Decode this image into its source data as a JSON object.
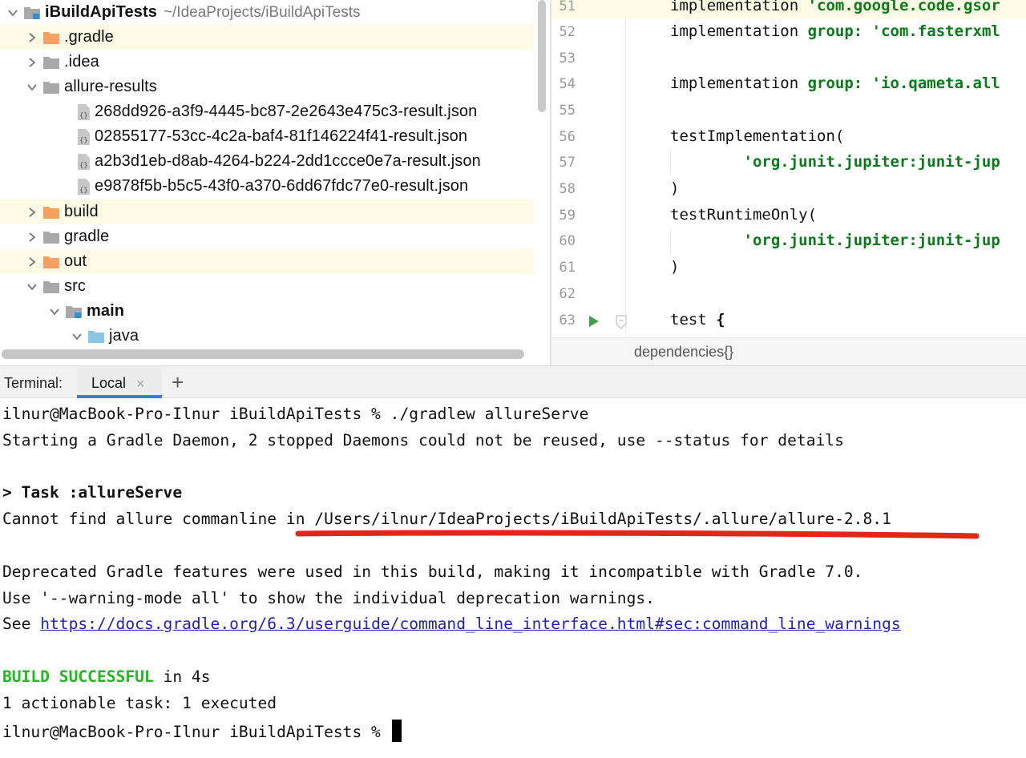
{
  "project_tree": {
    "root": {
      "label": "iBuildApiTests",
      "path": "~/IdeaProjects/iBuildApiTests"
    },
    "items": [
      {
        "label": ".gradle",
        "kind": "folder-orange",
        "expanded": false
      },
      {
        "label": ".idea",
        "kind": "folder-gray",
        "expanded": false
      },
      {
        "label": "allure-results",
        "kind": "folder-gray",
        "expanded": true
      },
      {
        "label": "268dd926-a3f9-4445-bc87-2e2643e475c3-result.json",
        "kind": "json-file"
      },
      {
        "label": "02855177-53cc-4c2a-baf4-81f146224f41-result.json",
        "kind": "json-file"
      },
      {
        "label": "a2b3d1eb-d8ab-4264-b224-2dd1ccce0e7a-result.json",
        "kind": "json-file"
      },
      {
        "label": "e9878f5b-b5c5-43f0-a370-6dd67fdc77e0-result.json",
        "kind": "json-file"
      },
      {
        "label": "build",
        "kind": "folder-orange",
        "expanded": false
      },
      {
        "label": "gradle",
        "kind": "folder-gray",
        "expanded": false
      },
      {
        "label": "out",
        "kind": "folder-orange",
        "expanded": false
      },
      {
        "label": "src",
        "kind": "folder-gray",
        "expanded": true
      },
      {
        "label": "main",
        "kind": "module-folder",
        "expanded": true
      },
      {
        "label": "java",
        "kind": "source-folder",
        "expanded": true
      }
    ]
  },
  "editor": {
    "lines": [
      {
        "num": "51",
        "p1": "implementation ",
        "p2": "",
        "p3": "'com.google.code.gsor"
      },
      {
        "num": "52",
        "p1": "implementation ",
        "p2": "group: ",
        "p3": "'com.fasterxml"
      },
      {
        "num": "53",
        "p1": "",
        "p2": "",
        "p3": ""
      },
      {
        "num": "54",
        "p1": "implementation ",
        "p2": "group: ",
        "p3": "'io.qameta.all"
      },
      {
        "num": "55",
        "p1": "",
        "p2": "",
        "p3": ""
      },
      {
        "num": "56",
        "p1": "testImplementation(",
        "p2": "",
        "p3": ""
      },
      {
        "num": "57",
        "p1": "        ",
        "p2": "",
        "p3": "'org.junit.jupiter:junit-jup"
      },
      {
        "num": "58",
        "p1": ")",
        "p2": "",
        "p3": ""
      },
      {
        "num": "59",
        "p1": "testRuntimeOnly(",
        "p2": "",
        "p3": ""
      },
      {
        "num": "60",
        "p1": "        ",
        "p2": "",
        "p3": "'org.junit.jupiter:junit-jup"
      },
      {
        "num": "61",
        "p1": ")",
        "p2": "",
        "p3": ""
      },
      {
        "num": "62",
        "p1": "",
        "p2": "",
        "p3": ""
      },
      {
        "num": "63",
        "p1": "test ",
        "p2": "",
        "p3": "",
        "brace": "{"
      }
    ],
    "breadcrumb": "dependencies{}"
  },
  "terminal": {
    "title": "Terminal:",
    "tab_label": "Local",
    "close_glyph": "×",
    "add_glyph": "+",
    "lines": {
      "l1": "ilnur@MacBook-Pro-Ilnur iBuildApiTests % ./gradlew allureServe",
      "l2": "Starting a Gradle Daemon, 2 stopped Daemons could not be reused, use --status for details",
      "l3_prefix": "> ",
      "l3_task": "Task :allureServe",
      "l4": "Cannot find allure commanline in /Users/ilnur/IdeaProjects/iBuildApiTests/.allure/allure-2.8.1",
      "l5": "Deprecated Gradle features were used in this build, making it incompatible with Gradle 7.0.",
      "l6": "Use '--warning-mode all' to show the individual deprecation warnings.",
      "l7_prefix": "See ",
      "l7_link": "https://docs.gradle.org/6.3/userguide/command_line_interface.html#sec:command_line_warnings",
      "l8_status": "BUILD SUCCESSFUL",
      "l8_rest": " in 4s",
      "l9": "1 actionable task: 1 executed",
      "l10": "ilnur@MacBook-Pro-Ilnur iBuildApiTests % "
    }
  },
  "colors": {
    "folder_orange": "#f4a261",
    "folder_gray": "#a9a9a9",
    "source_blue": "#8ac6e8",
    "module_blue": "#2f8fd8",
    "string_green": "#067d17",
    "success_green": "#1dbb1d",
    "link_blue": "#1f1fbf",
    "annotation_red": "#e3261a",
    "tab_accent": "#3d7bd4"
  },
  "icons": {
    "chevron_right": "chevron-right-icon",
    "chevron_down": "chevron-down-icon",
    "folder": "folder-icon",
    "json_file": "json-file-icon",
    "run": "run-gutter-icon",
    "fold": "fold-marker-icon"
  }
}
